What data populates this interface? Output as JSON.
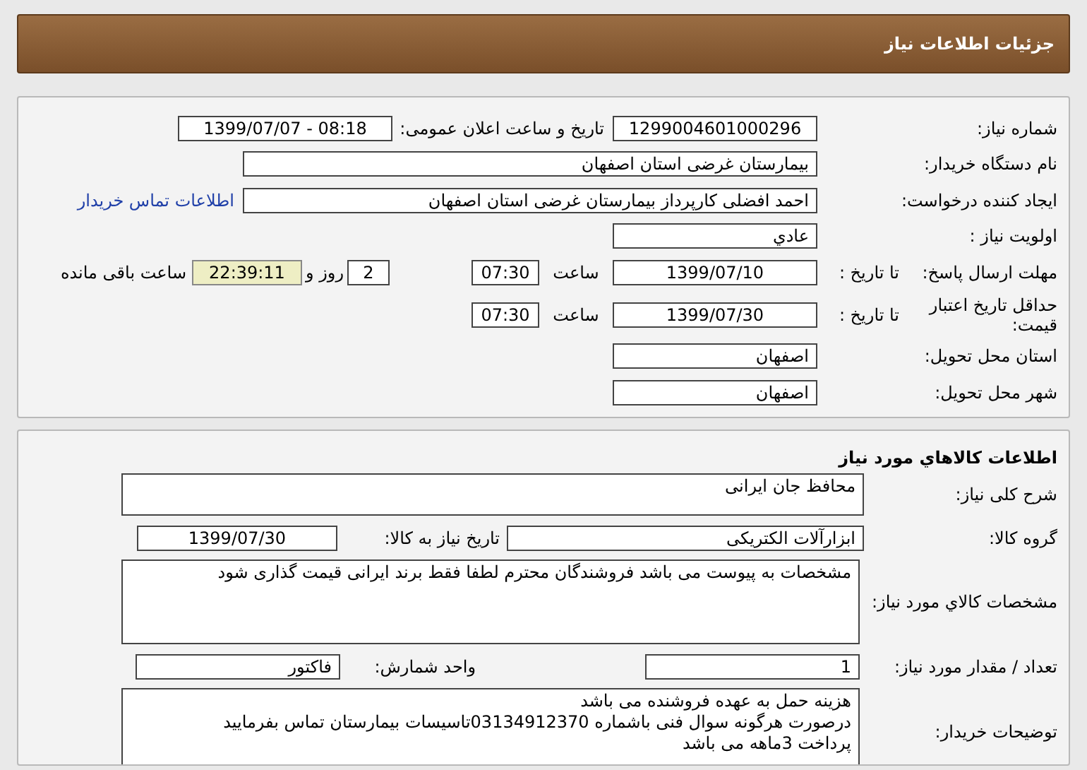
{
  "header": {
    "title": "جزئیات اطلاعات نیاز"
  },
  "need_info": {
    "need_number": {
      "label": "شماره نیاز:",
      "value": "1299004601000296"
    },
    "announce": {
      "label": "تاریخ و ساعت اعلان عمومی:",
      "value": "1399/07/07 - 08:18"
    },
    "buyer_org": {
      "label": "نام دستگاه خریدار:",
      "value": "بیمارستان غرضی استان اصفهان"
    },
    "requester": {
      "label": "ایجاد کننده درخواست:",
      "value": "احمد افضلی کارپرداز بیمارستان غرضی استان اصفهان",
      "link": "اطلاعات تماس خریدار"
    },
    "priority": {
      "label": "اولویت نیاز :",
      "value": "عادي"
    },
    "reply_deadline": {
      "label": "مهلت ارسال پاسخ:",
      "to_date_label": "تا تاریخ :",
      "date": "1399/07/10",
      "time_label": "ساعت",
      "time": "07:30",
      "days": "2",
      "days_label": "روز و",
      "remaining": "22:39:11",
      "remaining_label": "ساعت باقی مانده"
    },
    "price_validity": {
      "label": "حداقل تاریخ اعتبار قیمت:",
      "to_date_label": "تا تاریخ :",
      "date": "1399/07/30",
      "time_label": "ساعت",
      "time": "07:30"
    },
    "delivery_province": {
      "label": "استان محل تحویل:",
      "value": "اصفهان"
    },
    "delivery_city": {
      "label": "شهر محل تحویل:",
      "value": "اصفهان"
    }
  },
  "goods_info": {
    "title": "اطلاعات کالاهاي مورد نیاز",
    "summary": {
      "label": "شرح کلی نیاز:",
      "value": "محافظ جان ایرانی"
    },
    "group": {
      "label": "گروه کالا:",
      "value": "ابزارآلات الکتریکی"
    },
    "need_date": {
      "label": "تاریخ نیاز به کالا:",
      "value": "1399/07/30"
    },
    "specs": {
      "label": "مشخصات کالاي مورد نیاز:",
      "value": "مشخصات به پیوست می باشد فروشندگان محترم لطفا فقط برند ایرانی قیمت گذاری شود"
    },
    "quantity": {
      "label": "تعداد / مقدار مورد نیاز:",
      "value": "1"
    },
    "unit": {
      "label": "واحد شمارش:",
      "value": "فاکتور"
    },
    "buyer_notes": {
      "label": "توضیحات خریدار:",
      "lines": [
        "هزینه حمل به عهده فروشنده می باشد",
        "درصورت هرگونه سوال فنی باشماره 03134912370تاسیسات بیمارستان تماس بفرمایید",
        "پرداخت 3ماهه می باشد"
      ]
    }
  }
}
